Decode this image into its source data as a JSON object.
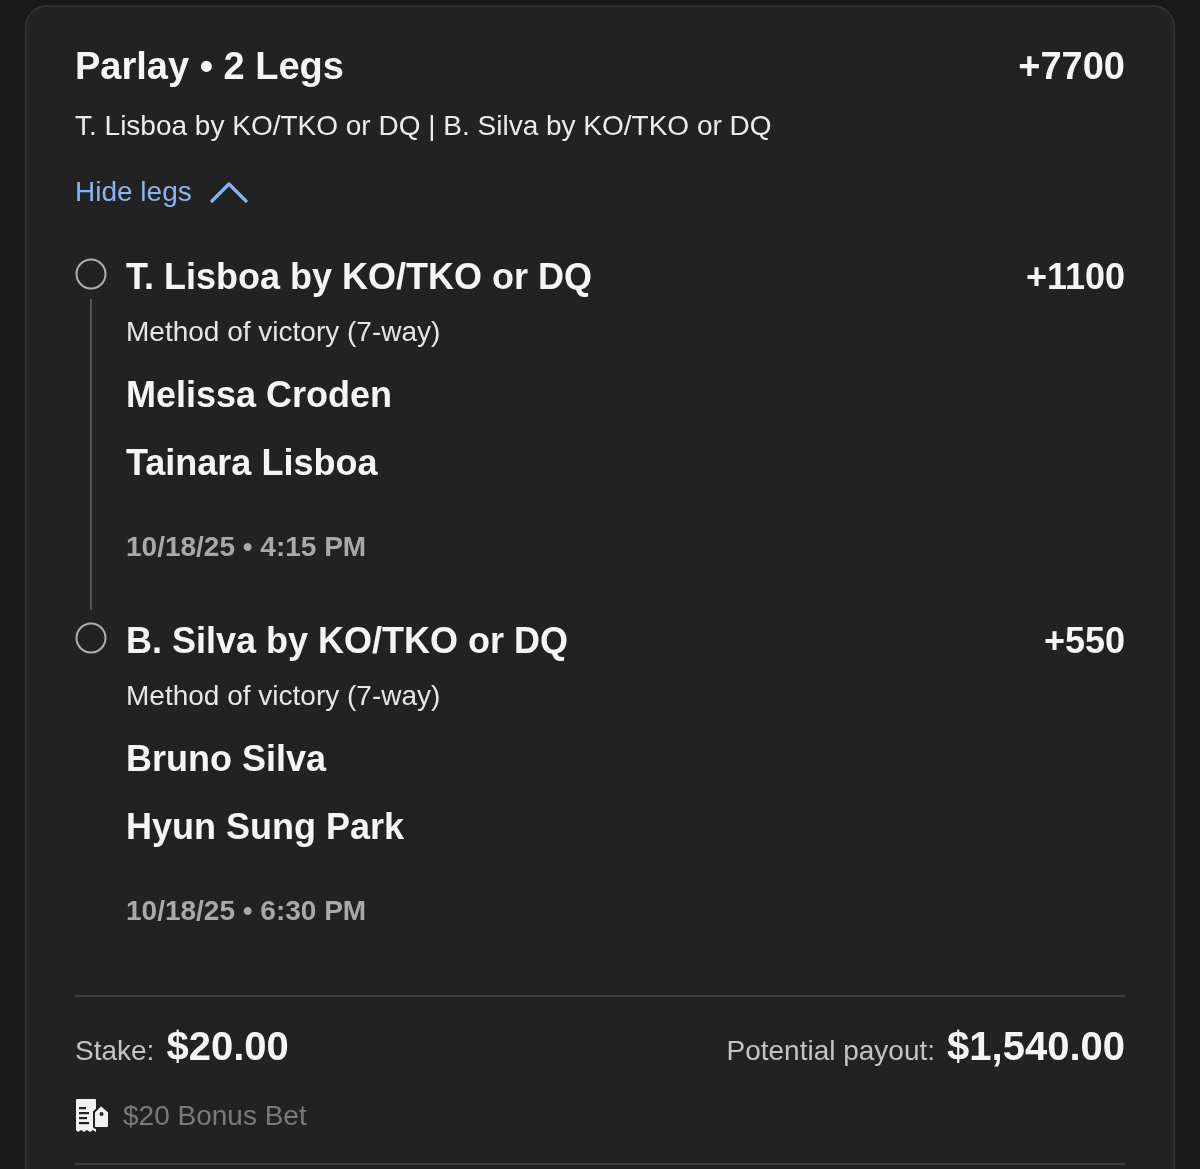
{
  "bet": {
    "title": "Parlay • 2 Legs",
    "odds": "+7700",
    "summary": "T. Lisboa by KO/TKO or DQ | B. Silva by KO/TKO or DQ",
    "toggle": {
      "label": "Hide legs",
      "expanded": true
    }
  },
  "legs": [
    {
      "selection": "T. Lisboa by KO/TKO or DQ",
      "odds": "+1100",
      "market": "Method of victory (7-way)",
      "competitors": [
        "Melissa Croden",
        "Tainara Lisboa"
      ],
      "datetime": "10/18/25 • 4:15 PM"
    },
    {
      "selection": "B. Silva by KO/TKO or DQ",
      "odds": "+550",
      "market": "Method of victory (7-way)",
      "competitors": [
        "Bruno Silva",
        "Hyun Sung Park"
      ],
      "datetime": "10/18/25 • 6:30 PM"
    }
  ],
  "footer": {
    "stake_label": "Stake:",
    "stake": "$20.00",
    "payout_label": "Potential payout:",
    "payout": "$1,540.00",
    "bonus": "$20 Bonus Bet"
  }
}
